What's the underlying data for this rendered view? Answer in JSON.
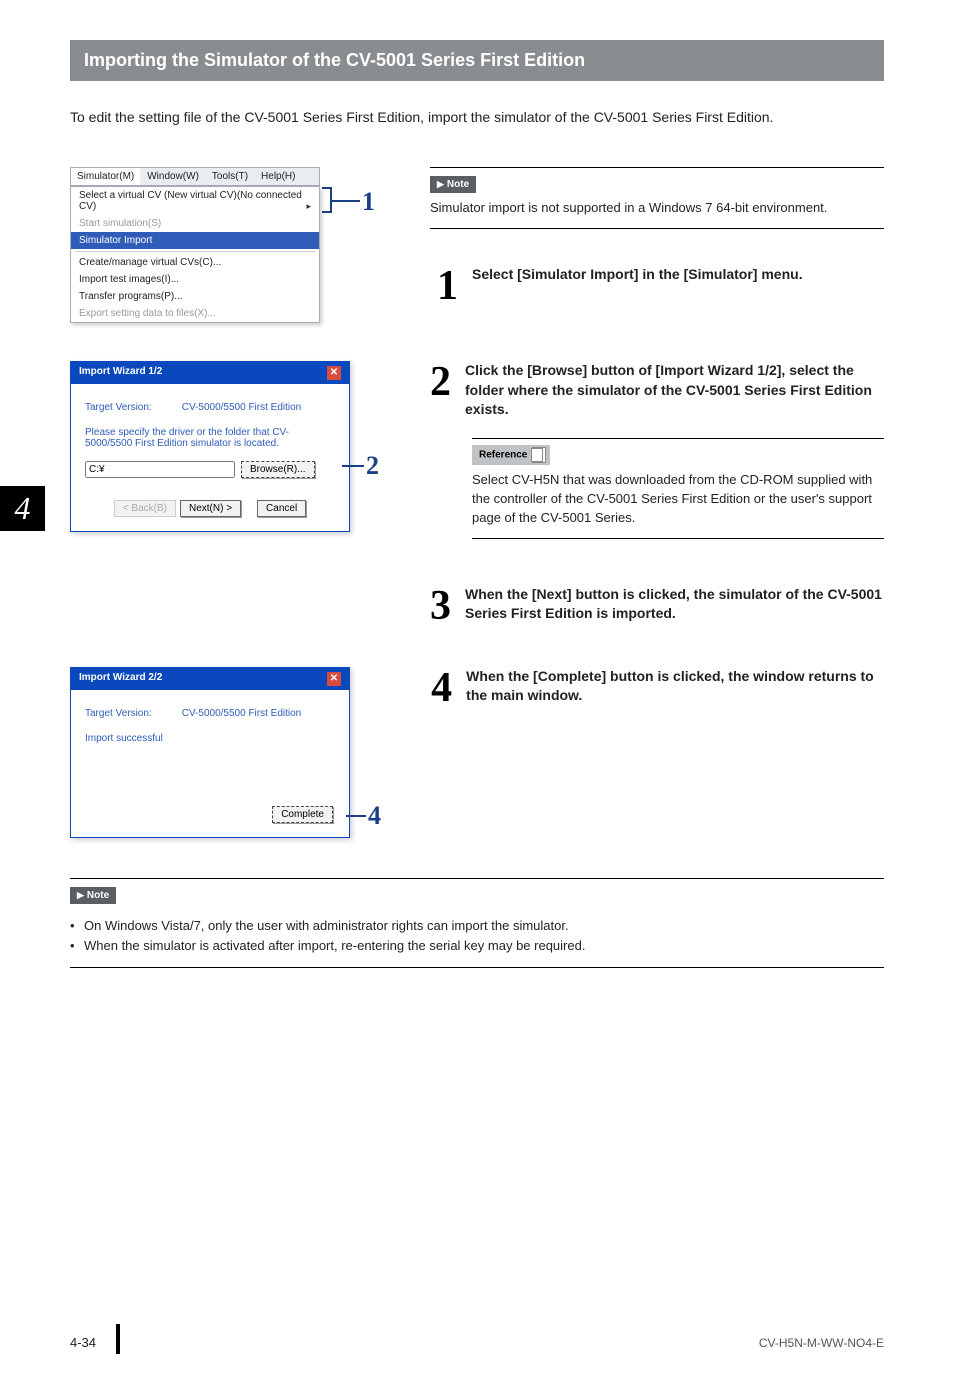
{
  "sidetab": "4",
  "heading": "Importing the Simulator of the CV-5001 Series First Edition",
  "intro": "To edit the setting file of the CV-5001 Series First Edition, import the simulator of the CV-5001 Series First Edition.",
  "noteLabel": "Note",
  "refLabel": "Reference",
  "noteTop": "Simulator import is not supported in a Windows 7 64-bit environment.",
  "steps": {
    "1": "Select [Simulator Import] in the [Simulator] menu.",
    "2": "Click the [Browse] button of [Import Wizard 1/2], select the folder where the simulator of the CV-5001 Series First Edition exists.",
    "2ref": "Select CV-H5N that was downloaded from the CD-ROM supplied with the controller of the CV-5001 Series First Edition or the user's support page of the CV-5001 Series.",
    "3": "When the [Next] button is clicked, the simulator of the CV-5001 Series First Edition is imported.",
    "4": "When the [Complete] button is clicked, the window returns to the main window."
  },
  "menu": {
    "items": [
      "Simulator(M)",
      "Window(W)",
      "Tools(T)",
      "Help(H)"
    ],
    "dd": {
      "selectVirtual": "Select a virtual CV (New virtual CV)(No connected CV)",
      "startSim": "Start simulation(S)",
      "simImport": "Simulator Import",
      "create": "Create/manage virtual CVs(C)...",
      "importTest": "Import test images(I)...",
      "transfer": "Transfer programs(P)...",
      "export": "Export setting data to files(X)..."
    }
  },
  "wizard1": {
    "title": "Import Wizard 1/2",
    "targetLabel": "Target Version:",
    "targetVal": "CV-5000/5500 First Edition",
    "prompt": "Please specify the driver or the folder that CV-5000/5500 First Edition simulator is located.",
    "path": "C:¥",
    "browse": "Browse(R)...",
    "back": "< Back(B)",
    "next": "Next(N) >",
    "cancel": "Cancel"
  },
  "wizard2": {
    "title": "Import Wizard 2/2",
    "targetLabel": "Target Version:",
    "targetVal": "CV-5000/5500 First Edition",
    "result": "Import successful",
    "complete": "Complete"
  },
  "bottomNotes": [
    "On Windows Vista/7, only the user with administrator rights can import the simulator.",
    "When the simulator is activated after import, re-entering the serial key may be required."
  ],
  "footer": {
    "page": "4-34",
    "code": "CV-H5N-M-WW-NO4-E"
  }
}
